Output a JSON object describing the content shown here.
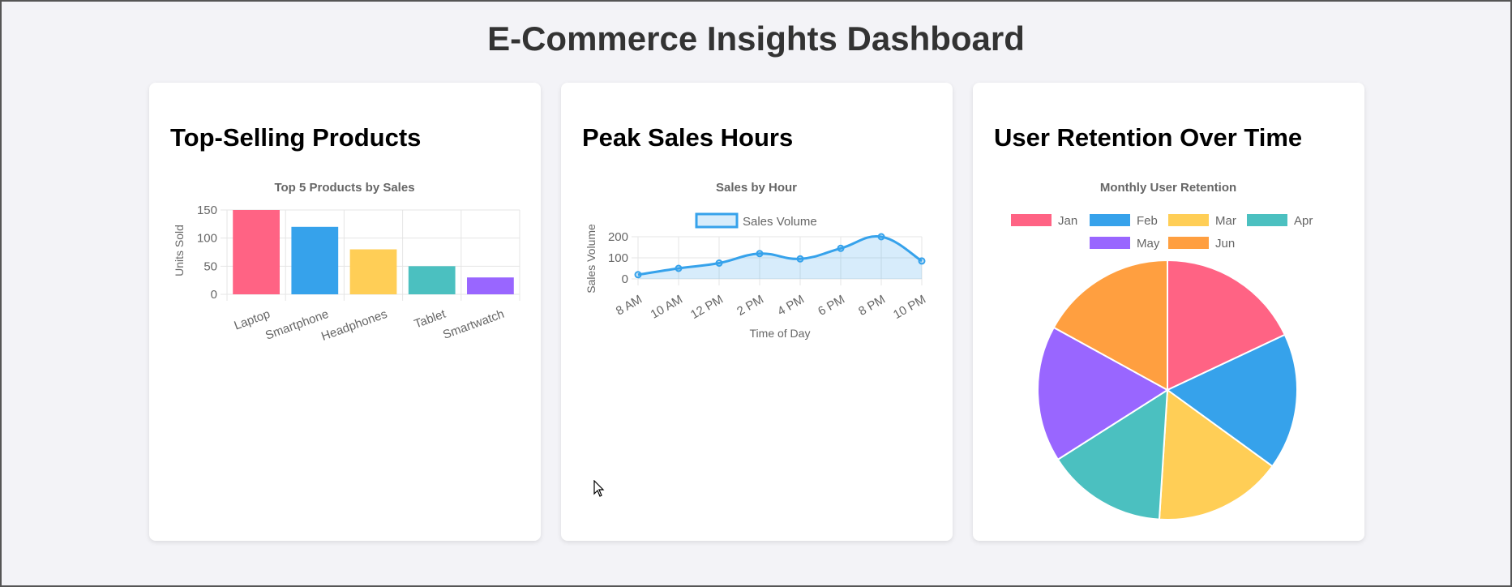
{
  "page": {
    "title": "E-Commerce Insights Dashboard"
  },
  "cards": [
    {
      "heading": "Top-Selling Products"
    },
    {
      "heading": "Peak Sales Hours"
    },
    {
      "heading": "User Retention Over Time"
    }
  ],
  "chart_data": [
    {
      "type": "bar",
      "title": "Top 5 Products by Sales",
      "xlabel": "",
      "ylabel": "Units Sold",
      "categories": [
        "Laptop",
        "Smartphone",
        "Headphones",
        "Tablet",
        "Smartwatch"
      ],
      "values": [
        150,
        120,
        80,
        50,
        30
      ],
      "colors": [
        "#ff6384",
        "#36a2eb",
        "#ffce56",
        "#4bc0c0",
        "#9966ff"
      ],
      "ylim": [
        0,
        150
      ],
      "yticks": [
        0,
        50,
        100,
        150
      ],
      "grid": true,
      "legend": "none"
    },
    {
      "type": "area",
      "title": "Sales by Hour",
      "xlabel": "Time of Day",
      "ylabel": "Sales Volume",
      "categories": [
        "8 AM",
        "10 AM",
        "12 PM",
        "2 PM",
        "4 PM",
        "6 PM",
        "8 PM",
        "10 PM"
      ],
      "series": [
        {
          "name": "Sales Volume",
          "values": [
            20,
            50,
            75,
            120,
            95,
            145,
            200,
            85
          ]
        }
      ],
      "ylim": [
        0,
        200
      ],
      "yticks": [
        0,
        100,
        200
      ],
      "color": "#36a2eb",
      "fill": "rgba(54,162,235,0.2)",
      "grid": true,
      "legend": "top"
    },
    {
      "type": "pie",
      "title": "Monthly User Retention",
      "categories": [
        "Jan",
        "Feb",
        "Mar",
        "Apr",
        "May",
        "Jun"
      ],
      "values": [
        18,
        17,
        16,
        15,
        17,
        17
      ],
      "colors": [
        "#ff6384",
        "#36a2eb",
        "#ffce56",
        "#4bc0c0",
        "#9966ff",
        "#ff9f40"
      ],
      "legend": "top"
    }
  ]
}
